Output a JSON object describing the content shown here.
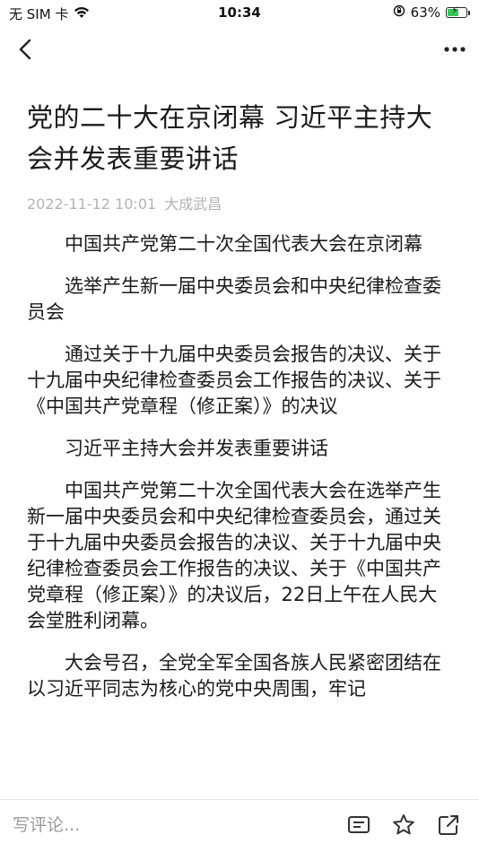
{
  "status_bar": {
    "carrier": "无 SIM 卡",
    "time": "10:34",
    "battery_text": "63%",
    "battery_level": 0.63
  },
  "nav": {
    "back_icon": "chevron-left-icon",
    "more_icon": "more-horizontal-icon"
  },
  "article": {
    "title": "党的二十大在京闭幕 习近平主持大会并发表重要讲话",
    "date": "2022-11-12 10:01",
    "source": "大成武昌",
    "paragraphs": [
      "中国共产党第二十次全国代表大会在京闭幕",
      "选举产生新一届中央委员会和中央纪律检查委员会",
      "通过关于十九届中央委员会报告的决议、关于十九届中央纪律检查委员会工作报告的决议、关于《中国共产党章程（修正案）》的决议",
      "习近平主持大会并发表重要讲话",
      "中国共产党第二十次全国代表大会在选举产生新一届中央委员会和中央纪律检查委员会，通过关于十九届中央委员会报告的决议、关于十九届中央纪律检查委员会工作报告的决议、关于《中国共产党章程（修正案）》的决议后，22日上午在人民大会堂胜利闭幕。",
      "大会号召，全党全军全国各族人民紧密团结在以习近平同志为核心的党中央周围，牢记"
    ]
  },
  "bottom_bar": {
    "comment_placeholder": "写评论...",
    "icons": [
      "comments-icon",
      "star-icon",
      "share-icon"
    ]
  }
}
